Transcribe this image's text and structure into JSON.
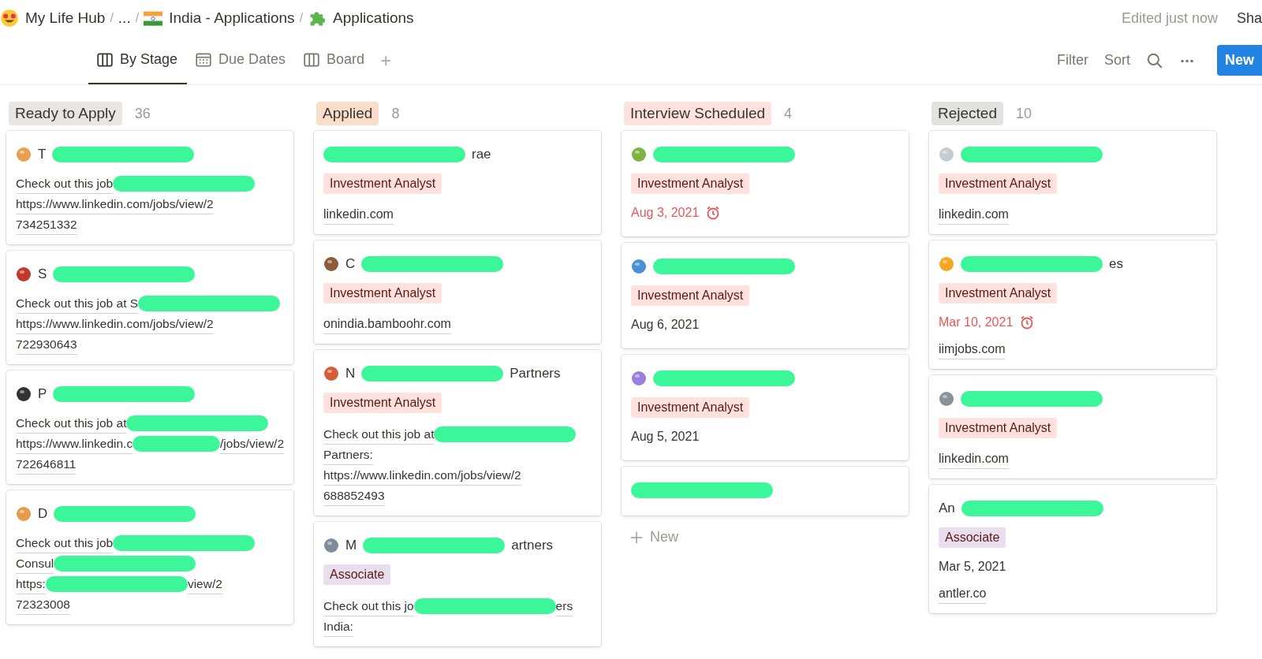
{
  "breadcrumbs": [
    {
      "label": "My Life Hub"
    },
    {
      "label": "..."
    },
    {
      "label": "India - Applications"
    },
    {
      "label": "Applications"
    }
  ],
  "separator": "/",
  "edited": "Edited just now",
  "share": "Sha",
  "views": [
    {
      "kind": "board",
      "label": "By Stage",
      "selected": true
    },
    {
      "kind": "calendar",
      "label": "Due Dates",
      "selected": false
    },
    {
      "kind": "board",
      "label": "Board",
      "selected": false
    }
  ],
  "add_view": "+",
  "toolbar": {
    "filter": "Filter",
    "sort": "Sort",
    "new_button": "New"
  },
  "groups": [
    {
      "label": "Ready to Apply",
      "count": "36",
      "color": "#e9e5e3",
      "cards": [
        {
          "has_icon": true,
          "title": [
            {
              "text": "T"
            },
            {
              "kind": "redaction"
            }
          ],
          "description": [
            [
              {
                "text": "Check out this job"
              },
              {
                "kind": "redaction"
              }
            ],
            [
              {
                "text": "https://www.linkedin.com/jobs/view/2"
              }
            ],
            [
              {
                "text": "734251332"
              }
            ]
          ]
        },
        {
          "has_icon": true,
          "title": [
            {
              "text": "S"
            },
            {
              "kind": "redaction"
            }
          ],
          "description": [
            [
              {
                "text": "Check out this job at S"
              },
              {
                "kind": "redaction"
              }
            ],
            [
              {
                "text": "https://www.linkedin.com/jobs/view/2"
              }
            ],
            [
              {
                "text": "722930643"
              }
            ]
          ]
        },
        {
          "has_icon": true,
          "title": [
            {
              "text": "P"
            },
            {
              "kind": "redaction"
            }
          ],
          "description": [
            [
              {
                "text": "Check out this job at"
              },
              {
                "kind": "redaction"
              }
            ],
            [
              {
                "text": "https://www.linkedin.c"
              },
              {
                "kind": "redaction"
              },
              {
                "text": "/jobs/view/2"
              }
            ],
            [
              {
                "text": "722646811"
              }
            ]
          ]
        },
        {
          "has_icon": true,
          "title": [
            {
              "text": "D"
            },
            {
              "kind": "redaction"
            }
          ],
          "description": [
            [
              {
                "text": "Check out this job"
              },
              {
                "kind": "redaction"
              }
            ],
            [
              {
                "text": "Consul"
              },
              {
                "kind": "redaction"
              }
            ],
            [
              {
                "text": "https:"
              },
              {
                "kind": "redaction"
              },
              {
                "text": "view/2"
              }
            ],
            [
              {
                "text": "72323008"
              }
            ]
          ]
        }
      ]
    },
    {
      "label": "Applied",
      "count": "8",
      "color": "#fadec9",
      "cards": [
        {
          "title": [
            {
              "kind": "redaction"
            },
            {
              "text": "rae"
            }
          ],
          "tag": {
            "label": "Investment Analyst",
            "color": "#ffe2dd"
          },
          "link": "linkedin.com"
        },
        {
          "has_icon": true,
          "title": [
            {
              "text": "C"
            },
            {
              "kind": "redaction"
            }
          ],
          "tag": {
            "label": "Investment Analyst",
            "color": "#ffe2dd"
          },
          "link": "onindia.bamboohr.com"
        },
        {
          "has_icon": true,
          "title": [
            {
              "text": "N"
            },
            {
              "kind": "redaction"
            },
            {
              "text": "Partners"
            }
          ],
          "tag": {
            "label": "Investment Analyst",
            "color": "#ffe2dd"
          },
          "description": [
            [
              {
                "text": "Check out this job at"
              },
              {
                "kind": "redaction"
              }
            ],
            [
              {
                "text": "Partners:"
              }
            ],
            [
              {
                "text": "https://www.linkedin.com/jobs/view/2"
              }
            ],
            [
              {
                "text": "688852493"
              }
            ]
          ]
        },
        {
          "has_icon": true,
          "title": [
            {
              "text": "M"
            },
            {
              "kind": "redaction"
            },
            {
              "text": "artners"
            }
          ],
          "tag": {
            "label": "Associate",
            "color": "#e8deee"
          },
          "description": [
            [
              {
                "text": "Check out this jo"
              },
              {
                "kind": "redaction"
              },
              {
                "text": "ers"
              }
            ],
            [
              {
                "text": "India:"
              }
            ]
          ]
        }
      ]
    },
    {
      "label": "Interview Scheduled",
      "count": "4",
      "color": "#ffe2dd",
      "cards": [
        {
          "has_icon": true,
          "title": [
            {
              "kind": "redaction"
            }
          ],
          "tag": {
            "label": "Investment Analyst",
            "color": "#ffe2dd"
          },
          "date": {
            "text": "Aug 3, 2021",
            "overdue": true
          }
        },
        {
          "has_icon": true,
          "title": [
            {
              "kind": "redaction"
            }
          ],
          "tag": {
            "label": "Investment Analyst",
            "color": "#ffe2dd"
          },
          "date": {
            "text": "Aug 6, 2021",
            "overdue": false
          }
        },
        {
          "has_icon": true,
          "title": [
            {
              "kind": "redaction"
            }
          ],
          "tag": {
            "label": "Investment Analyst",
            "color": "#ffe2dd"
          },
          "date": {
            "text": "Aug 5, 2021",
            "overdue": false
          }
        },
        {
          "title": [
            {
              "kind": "redaction"
            }
          ]
        }
      ],
      "new_label": "New"
    },
    {
      "label": "Rejected",
      "count": "10",
      "color": "#e3e2e0",
      "cards": [
        {
          "has_icon": true,
          "title": [
            {
              "kind": "redaction"
            }
          ],
          "tag": {
            "label": "Investment Analyst",
            "color": "#ffe2dd"
          },
          "link": "linkedin.com"
        },
        {
          "has_icon": true,
          "title": [
            {
              "kind": "redaction"
            },
            {
              "text": "es"
            }
          ],
          "tag": {
            "label": "Investment Analyst",
            "color": "#ffe2dd"
          },
          "date": {
            "text": "Mar 10, 2021",
            "overdue": true
          },
          "link": "iimjobs.com"
        },
        {
          "has_icon": true,
          "title": [
            {
              "kind": "redaction"
            }
          ],
          "tag": {
            "label": "Investment Analyst",
            "color": "#ffe2dd"
          },
          "link": "linkedin.com"
        },
        {
          "title": [
            {
              "text": "An"
            },
            {
              "kind": "redaction"
            }
          ],
          "tag": {
            "label": "Associate",
            "color": "#e8deee"
          },
          "date": {
            "text": "Mar 5, 2021",
            "overdue": false
          },
          "link": "antler.co"
        }
      ]
    }
  ]
}
